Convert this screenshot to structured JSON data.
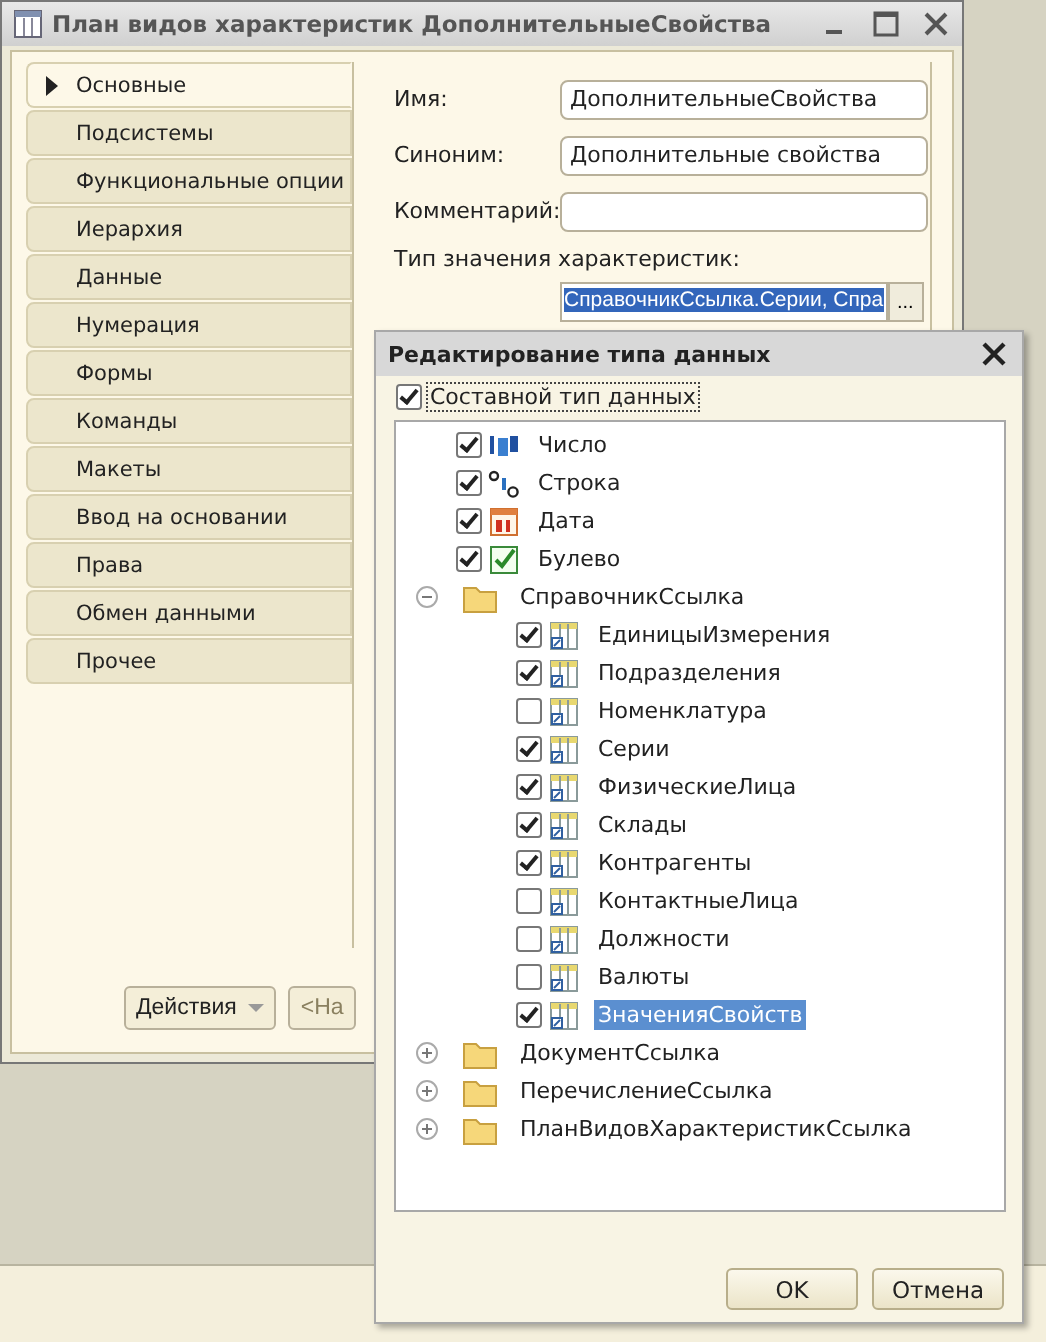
{
  "window": {
    "title": "План видов характеристик ДополнительныеСвойства"
  },
  "tabs": [
    {
      "label": "Основные",
      "selected": true
    },
    {
      "label": "Подсистемы",
      "selected": false
    },
    {
      "label": "Функциональные опции",
      "selected": false
    },
    {
      "label": "Иерархия",
      "selected": false
    },
    {
      "label": "Данные",
      "selected": false
    },
    {
      "label": "Нумерация",
      "selected": false
    },
    {
      "label": "Формы",
      "selected": false
    },
    {
      "label": "Команды",
      "selected": false
    },
    {
      "label": "Макеты",
      "selected": false
    },
    {
      "label": "Ввод на основании",
      "selected": false
    },
    {
      "label": "Права",
      "selected": false
    },
    {
      "label": "Обмен данными",
      "selected": false
    },
    {
      "label": "Прочее",
      "selected": false
    }
  ],
  "fields": [
    {
      "label": "Имя:",
      "value": "ДополнительныеСвойства"
    },
    {
      "label": "Синоним:",
      "value": "Дополнительные свойства"
    },
    {
      "label": "Комментарий:"
    }
  ],
  "type_field": {
    "label": "Тип значения характеристик:",
    "value": "СправочникСсылка.Серии, Спра",
    "button": "..."
  },
  "bottom_buttons": [
    {
      "label": "Действия",
      "disabled": false
    },
    {
      "label": "<На",
      "disabled": true
    }
  ],
  "dialog": {
    "title": "Редактирование типа данных",
    "composite": {
      "label": "Составной тип данных",
      "checked": true
    },
    "tree": [
      {
        "kind": "number",
        "label": "Число",
        "checked": true,
        "selected": false
      },
      {
        "kind": "string",
        "label": "Строка",
        "checked": true,
        "selected": false
      },
      {
        "kind": "date",
        "label": "Дата",
        "checked": true,
        "selected": false
      },
      {
        "kind": "boolean",
        "label": "Булево",
        "checked": true,
        "selected": false
      },
      {
        "kind": "folder",
        "label": "СправочникСсылка",
        "expanded": true,
        "selected": false,
        "children": [
          {
            "kind": "catalog",
            "label": "ЕдиницыИзмерения",
            "checked": true,
            "selected": false
          },
          {
            "kind": "catalog",
            "label": "Подразделения",
            "checked": true,
            "selected": false
          },
          {
            "kind": "catalog",
            "label": "Номенклатура",
            "checked": false,
            "selected": false
          },
          {
            "kind": "catalog",
            "label": "Серии",
            "checked": true,
            "selected": false
          },
          {
            "kind": "catalog",
            "label": "ФизическиеЛица",
            "checked": true,
            "selected": false
          },
          {
            "kind": "catalog",
            "label": "Склады",
            "checked": true,
            "selected": false
          },
          {
            "kind": "catalog",
            "label": "Контрагенты",
            "checked": true,
            "selected": false
          },
          {
            "kind": "catalog",
            "label": "КонтактныеЛица",
            "checked": false,
            "selected": false
          },
          {
            "kind": "catalog",
            "label": "Должности",
            "checked": false,
            "selected": false
          },
          {
            "kind": "catalog",
            "label": "Валюты",
            "checked": false,
            "selected": false
          },
          {
            "kind": "catalog",
            "label": "ЗначенияСвойств",
            "checked": true,
            "selected": true
          }
        ]
      },
      {
        "kind": "folder",
        "label": "ДокументСсылка",
        "expanded": false,
        "selected": false
      },
      {
        "kind": "folder",
        "label": "ПеречислениеСсылка",
        "expanded": false,
        "selected": false
      },
      {
        "kind": "folder",
        "label": "ПланВидовХарактеристикСсылка",
        "expanded": false,
        "selected": false
      }
    ],
    "buttons": [
      "OK",
      "Отмена"
    ]
  }
}
